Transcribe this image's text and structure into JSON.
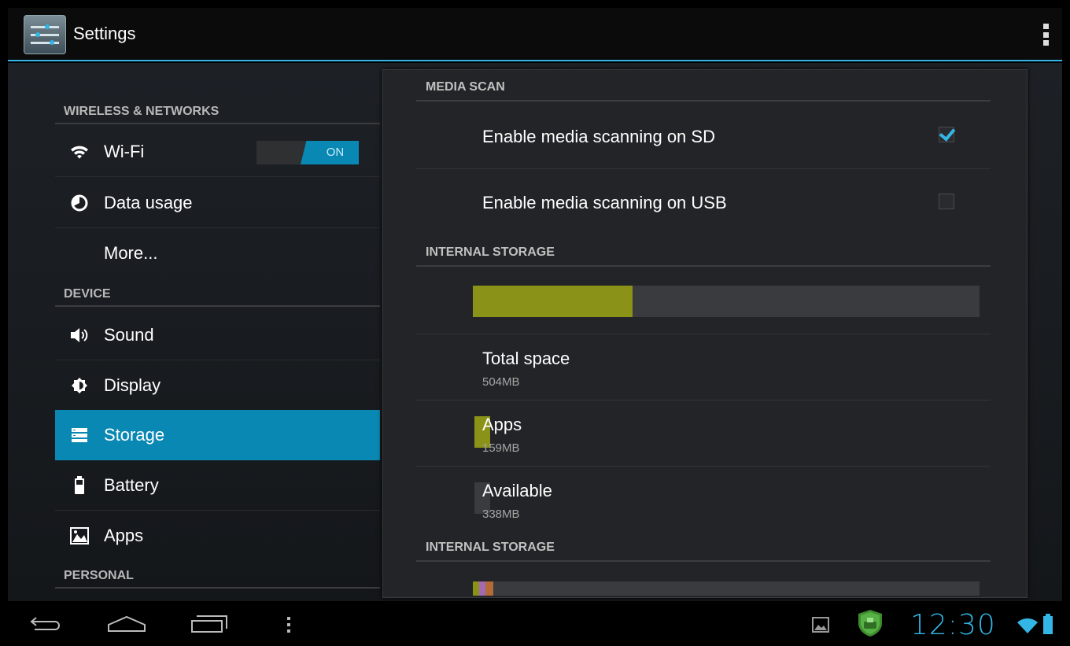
{
  "app": {
    "title": "Settings"
  },
  "left_nav": {
    "categories": {
      "wireless": "WIRELESS & NETWORKS",
      "device": "DEVICE",
      "personal": "PERSONAL"
    },
    "items": {
      "wifi": {
        "label": "Wi-Fi",
        "icon": "wifi-icon",
        "toggle": "ON"
      },
      "data_usage": {
        "label": "Data usage",
        "icon": "data-usage-icon"
      },
      "more": {
        "label": "More..."
      },
      "sound": {
        "label": "Sound",
        "icon": "speaker-icon"
      },
      "display": {
        "label": "Display",
        "icon": "brightness-icon"
      },
      "storage": {
        "label": "Storage",
        "icon": "storage-icon",
        "selected": true
      },
      "battery": {
        "label": "Battery",
        "icon": "battery-icon"
      },
      "apps": {
        "label": "Apps",
        "icon": "apps-icon"
      }
    }
  },
  "storage_panel": {
    "media_scan": {
      "header": "MEDIA SCAN",
      "sd": {
        "label": "Enable media scanning on SD",
        "checked": true
      },
      "usb": {
        "label": "Enable media scanning on USB",
        "checked": false
      }
    },
    "internal": {
      "header": "INTERNAL STORAGE",
      "used_fraction": 0.315,
      "total": {
        "label": "Total space",
        "value": "504MB"
      },
      "apps": {
        "label": "Apps",
        "value": "159MB",
        "color": "#8a9318"
      },
      "available": {
        "label": "Available",
        "value": "338MB",
        "color": "#3a3b3e"
      }
    },
    "internal2": {
      "header": "INTERNAL STORAGE"
    }
  },
  "status_bar": {
    "time": "12:30",
    "accent": "#33b5e5"
  }
}
